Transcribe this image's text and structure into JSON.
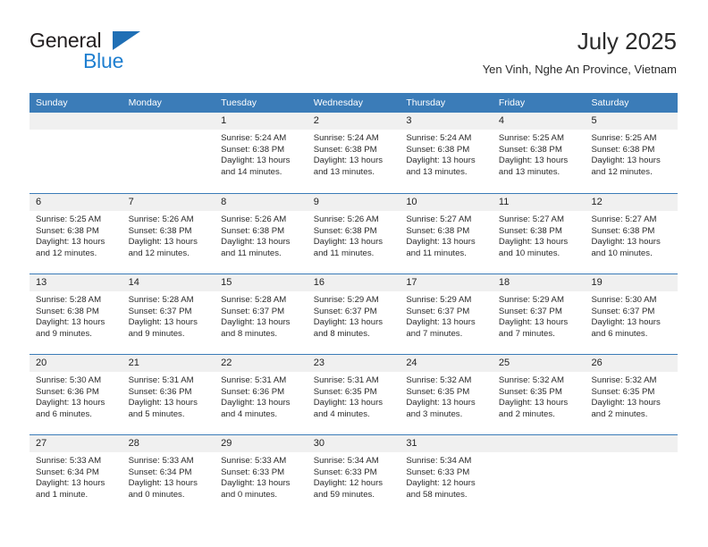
{
  "brand": {
    "name_top": "General",
    "name_bottom": "Blue",
    "triangle_color": "#1f6fb5",
    "blue_text_color": "#1f7fd0"
  },
  "header": {
    "title": "July 2025",
    "subtitle": "Yen Vinh, Nghe An Province, Vietnam"
  },
  "theme": {
    "header_blue": "#3b7cb8",
    "day_number_bg": "#f0f0f0",
    "text_color": "#2b2b2b"
  },
  "weekdays": [
    "Sunday",
    "Monday",
    "Tuesday",
    "Wednesday",
    "Thursday",
    "Friday",
    "Saturday"
  ],
  "weeks": [
    [
      {
        "day": "",
        "sunrise": "",
        "sunset": "",
        "daylight": ""
      },
      {
        "day": "",
        "sunrise": "",
        "sunset": "",
        "daylight": ""
      },
      {
        "day": "1",
        "sunrise": "Sunrise: 5:24 AM",
        "sunset": "Sunset: 6:38 PM",
        "daylight": "Daylight: 13 hours and 14 minutes."
      },
      {
        "day": "2",
        "sunrise": "Sunrise: 5:24 AM",
        "sunset": "Sunset: 6:38 PM",
        "daylight": "Daylight: 13 hours and 13 minutes."
      },
      {
        "day": "3",
        "sunrise": "Sunrise: 5:24 AM",
        "sunset": "Sunset: 6:38 PM",
        "daylight": "Daylight: 13 hours and 13 minutes."
      },
      {
        "day": "4",
        "sunrise": "Sunrise: 5:25 AM",
        "sunset": "Sunset: 6:38 PM",
        "daylight": "Daylight: 13 hours and 13 minutes."
      },
      {
        "day": "5",
        "sunrise": "Sunrise: 5:25 AM",
        "sunset": "Sunset: 6:38 PM",
        "daylight": "Daylight: 13 hours and 12 minutes."
      }
    ],
    [
      {
        "day": "6",
        "sunrise": "Sunrise: 5:25 AM",
        "sunset": "Sunset: 6:38 PM",
        "daylight": "Daylight: 13 hours and 12 minutes."
      },
      {
        "day": "7",
        "sunrise": "Sunrise: 5:26 AM",
        "sunset": "Sunset: 6:38 PM",
        "daylight": "Daylight: 13 hours and 12 minutes."
      },
      {
        "day": "8",
        "sunrise": "Sunrise: 5:26 AM",
        "sunset": "Sunset: 6:38 PM",
        "daylight": "Daylight: 13 hours and 11 minutes."
      },
      {
        "day": "9",
        "sunrise": "Sunrise: 5:26 AM",
        "sunset": "Sunset: 6:38 PM",
        "daylight": "Daylight: 13 hours and 11 minutes."
      },
      {
        "day": "10",
        "sunrise": "Sunrise: 5:27 AM",
        "sunset": "Sunset: 6:38 PM",
        "daylight": "Daylight: 13 hours and 11 minutes."
      },
      {
        "day": "11",
        "sunrise": "Sunrise: 5:27 AM",
        "sunset": "Sunset: 6:38 PM",
        "daylight": "Daylight: 13 hours and 10 minutes."
      },
      {
        "day": "12",
        "sunrise": "Sunrise: 5:27 AM",
        "sunset": "Sunset: 6:38 PM",
        "daylight": "Daylight: 13 hours and 10 minutes."
      }
    ],
    [
      {
        "day": "13",
        "sunrise": "Sunrise: 5:28 AM",
        "sunset": "Sunset: 6:38 PM",
        "daylight": "Daylight: 13 hours and 9 minutes."
      },
      {
        "day": "14",
        "sunrise": "Sunrise: 5:28 AM",
        "sunset": "Sunset: 6:37 PM",
        "daylight": "Daylight: 13 hours and 9 minutes."
      },
      {
        "day": "15",
        "sunrise": "Sunrise: 5:28 AM",
        "sunset": "Sunset: 6:37 PM",
        "daylight": "Daylight: 13 hours and 8 minutes."
      },
      {
        "day": "16",
        "sunrise": "Sunrise: 5:29 AM",
        "sunset": "Sunset: 6:37 PM",
        "daylight": "Daylight: 13 hours and 8 minutes."
      },
      {
        "day": "17",
        "sunrise": "Sunrise: 5:29 AM",
        "sunset": "Sunset: 6:37 PM",
        "daylight": "Daylight: 13 hours and 7 minutes."
      },
      {
        "day": "18",
        "sunrise": "Sunrise: 5:29 AM",
        "sunset": "Sunset: 6:37 PM",
        "daylight": "Daylight: 13 hours and 7 minutes."
      },
      {
        "day": "19",
        "sunrise": "Sunrise: 5:30 AM",
        "sunset": "Sunset: 6:37 PM",
        "daylight": "Daylight: 13 hours and 6 minutes."
      }
    ],
    [
      {
        "day": "20",
        "sunrise": "Sunrise: 5:30 AM",
        "sunset": "Sunset: 6:36 PM",
        "daylight": "Daylight: 13 hours and 6 minutes."
      },
      {
        "day": "21",
        "sunrise": "Sunrise: 5:31 AM",
        "sunset": "Sunset: 6:36 PM",
        "daylight": "Daylight: 13 hours and 5 minutes."
      },
      {
        "day": "22",
        "sunrise": "Sunrise: 5:31 AM",
        "sunset": "Sunset: 6:36 PM",
        "daylight": "Daylight: 13 hours and 4 minutes."
      },
      {
        "day": "23",
        "sunrise": "Sunrise: 5:31 AM",
        "sunset": "Sunset: 6:35 PM",
        "daylight": "Daylight: 13 hours and 4 minutes."
      },
      {
        "day": "24",
        "sunrise": "Sunrise: 5:32 AM",
        "sunset": "Sunset: 6:35 PM",
        "daylight": "Daylight: 13 hours and 3 minutes."
      },
      {
        "day": "25",
        "sunrise": "Sunrise: 5:32 AM",
        "sunset": "Sunset: 6:35 PM",
        "daylight": "Daylight: 13 hours and 2 minutes."
      },
      {
        "day": "26",
        "sunrise": "Sunrise: 5:32 AM",
        "sunset": "Sunset: 6:35 PM",
        "daylight": "Daylight: 13 hours and 2 minutes."
      }
    ],
    [
      {
        "day": "27",
        "sunrise": "Sunrise: 5:33 AM",
        "sunset": "Sunset: 6:34 PM",
        "daylight": "Daylight: 13 hours and 1 minute."
      },
      {
        "day": "28",
        "sunrise": "Sunrise: 5:33 AM",
        "sunset": "Sunset: 6:34 PM",
        "daylight": "Daylight: 13 hours and 0 minutes."
      },
      {
        "day": "29",
        "sunrise": "Sunrise: 5:33 AM",
        "sunset": "Sunset: 6:33 PM",
        "daylight": "Daylight: 13 hours and 0 minutes."
      },
      {
        "day": "30",
        "sunrise": "Sunrise: 5:34 AM",
        "sunset": "Sunset: 6:33 PM",
        "daylight": "Daylight: 12 hours and 59 minutes."
      },
      {
        "day": "31",
        "sunrise": "Sunrise: 5:34 AM",
        "sunset": "Sunset: 6:33 PM",
        "daylight": "Daylight: 12 hours and 58 minutes."
      },
      {
        "day": "",
        "sunrise": "",
        "sunset": "",
        "daylight": ""
      },
      {
        "day": "",
        "sunrise": "",
        "sunset": "",
        "daylight": ""
      }
    ]
  ]
}
